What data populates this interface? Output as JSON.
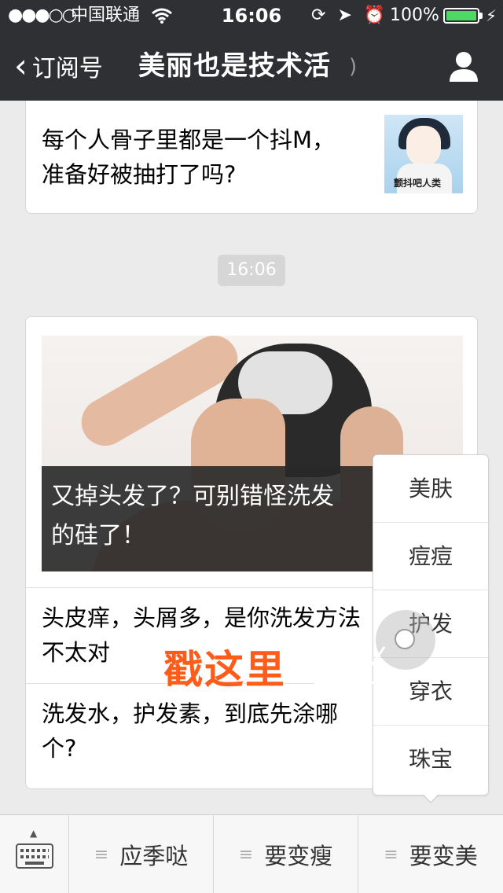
{
  "status_bar": {
    "signal": "●●●○○",
    "carrier": "中国联通",
    "wifi_icon": "wifi-icon",
    "time": "16:06",
    "right_icons": "⟳ ➤ ⏰",
    "battery_pct": "100%",
    "battery_color": "#4cd964"
  },
  "nav": {
    "back_label": "订阅号",
    "title": "美丽也是技术活",
    "ear_icon": "ear-icon",
    "profile_icon": "person-icon"
  },
  "top_card": {
    "text": "每个人骨子里都是一个抖M，准备好被抽打了吗?",
    "thumb_caption": "颤抖吧人类"
  },
  "time_badge": "16:06",
  "main_card": {
    "headline": "又掉头发了？可别错怪洗发水里的硅了！",
    "headline_visible": "又掉头发了？可别错怪洗发",
    "headline_line2": "的硅了！",
    "items": [
      {
        "text": "头皮痒，头屑多，是你洗发方法不太对"
      },
      {
        "text": "洗发水，护发素，到底先涂哪个?"
      }
    ]
  },
  "popup_menu": {
    "items": [
      "美肤",
      "痘痘",
      "护发",
      "穿衣",
      "珠宝"
    ]
  },
  "annotation": {
    "label": "戳这里",
    "color": "#ff5c1a"
  },
  "bottom_bar": {
    "keyboard_icon": "keyboard-icon",
    "tabs": [
      "应季哒",
      "要变瘦",
      "要变美"
    ]
  }
}
